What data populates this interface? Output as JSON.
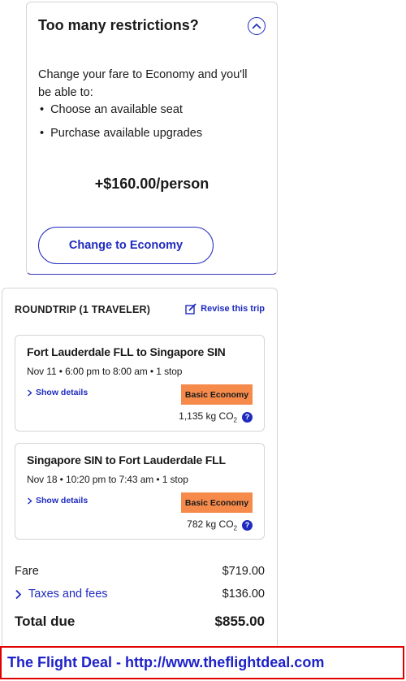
{
  "upsell": {
    "title": "Too many restrictions?",
    "description": "Change your fare to Economy and you'll be able to:",
    "benefits": [
      "Choose an available seat",
      "Purchase available upgrades"
    ],
    "price": "+$160.00/person",
    "button_label": "Change to Economy"
  },
  "trip": {
    "heading": "ROUNDTRIP (1 TRAVELER)",
    "revise_label": "Revise this trip",
    "flights": [
      {
        "route": "Fort Lauderdale FLL to Singapore SIN",
        "times": "Nov 11 • 6:00 pm to 8:00 am • 1 stop",
        "details_label": "Show details",
        "fare_class": "Basic Economy",
        "co2_value": "1,135 kg CO",
        "co2_sub": "2"
      },
      {
        "route": "Singapore SIN to Fort Lauderdale FLL",
        "times": "Nov 18 • 10:20 pm to 7:43 am • 1 stop",
        "details_label": "Show details",
        "fare_class": "Basic Economy",
        "co2_value": "782 kg CO",
        "co2_sub": "2"
      }
    ],
    "fare_label": "Fare",
    "fare_value": "$719.00",
    "taxes_label": "Taxes and fees",
    "taxes_value": "$136.00",
    "total_label": "Total due",
    "total_value": "$855.00"
  },
  "banner": {
    "text": "The Flight Deal - http://www.theflightdeal.com"
  },
  "colors": {
    "accent": "#1f2bbf",
    "fare_badge": "#f58a4b",
    "banner_border": "#e00000",
    "banner_text": "#1e22c9"
  }
}
